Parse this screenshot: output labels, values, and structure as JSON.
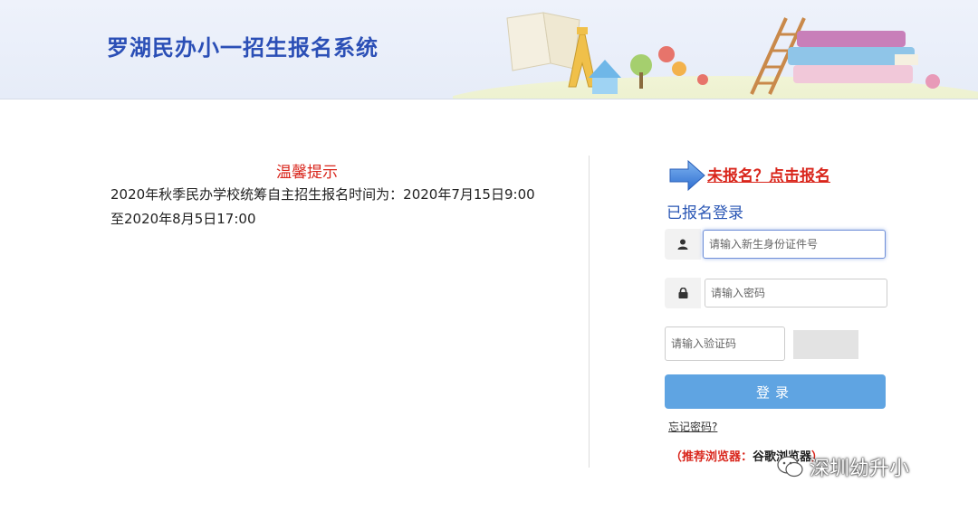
{
  "header": {
    "title": "罗湖民办小一招生报名系统"
  },
  "notice": {
    "title": "温馨提示",
    "body": "2020年秋季民办学校统筹自主招生报名时间为：2020年7月15日9:00至2020年8月5日17:00"
  },
  "register": {
    "link_text": "未报名？点击报名"
  },
  "login": {
    "heading": "已报名登录",
    "id_field": {
      "placeholder": "请输入新生身份证件号",
      "value": ""
    },
    "password_field": {
      "placeholder": "请输入密码",
      "value": ""
    },
    "captcha_field": {
      "placeholder": "请输入验证码",
      "value": ""
    },
    "submit_label": "登录",
    "forgot_label": "忘记密码?",
    "browser_tip_prefix": "（推荐浏览器：",
    "browser_tip_name": "谷歌浏览器",
    "browser_tip_suffix": "）"
  },
  "watermark": {
    "text": "深圳幼升小"
  },
  "icons": {
    "user": "user-icon",
    "lock": "lock-icon",
    "arrow": "arrow-right-icon",
    "wechat": "wechat-icon"
  },
  "colors": {
    "brand_blue": "#2b4fb6",
    "alert_red": "#d9261c",
    "button_blue": "#5fa4e2"
  }
}
